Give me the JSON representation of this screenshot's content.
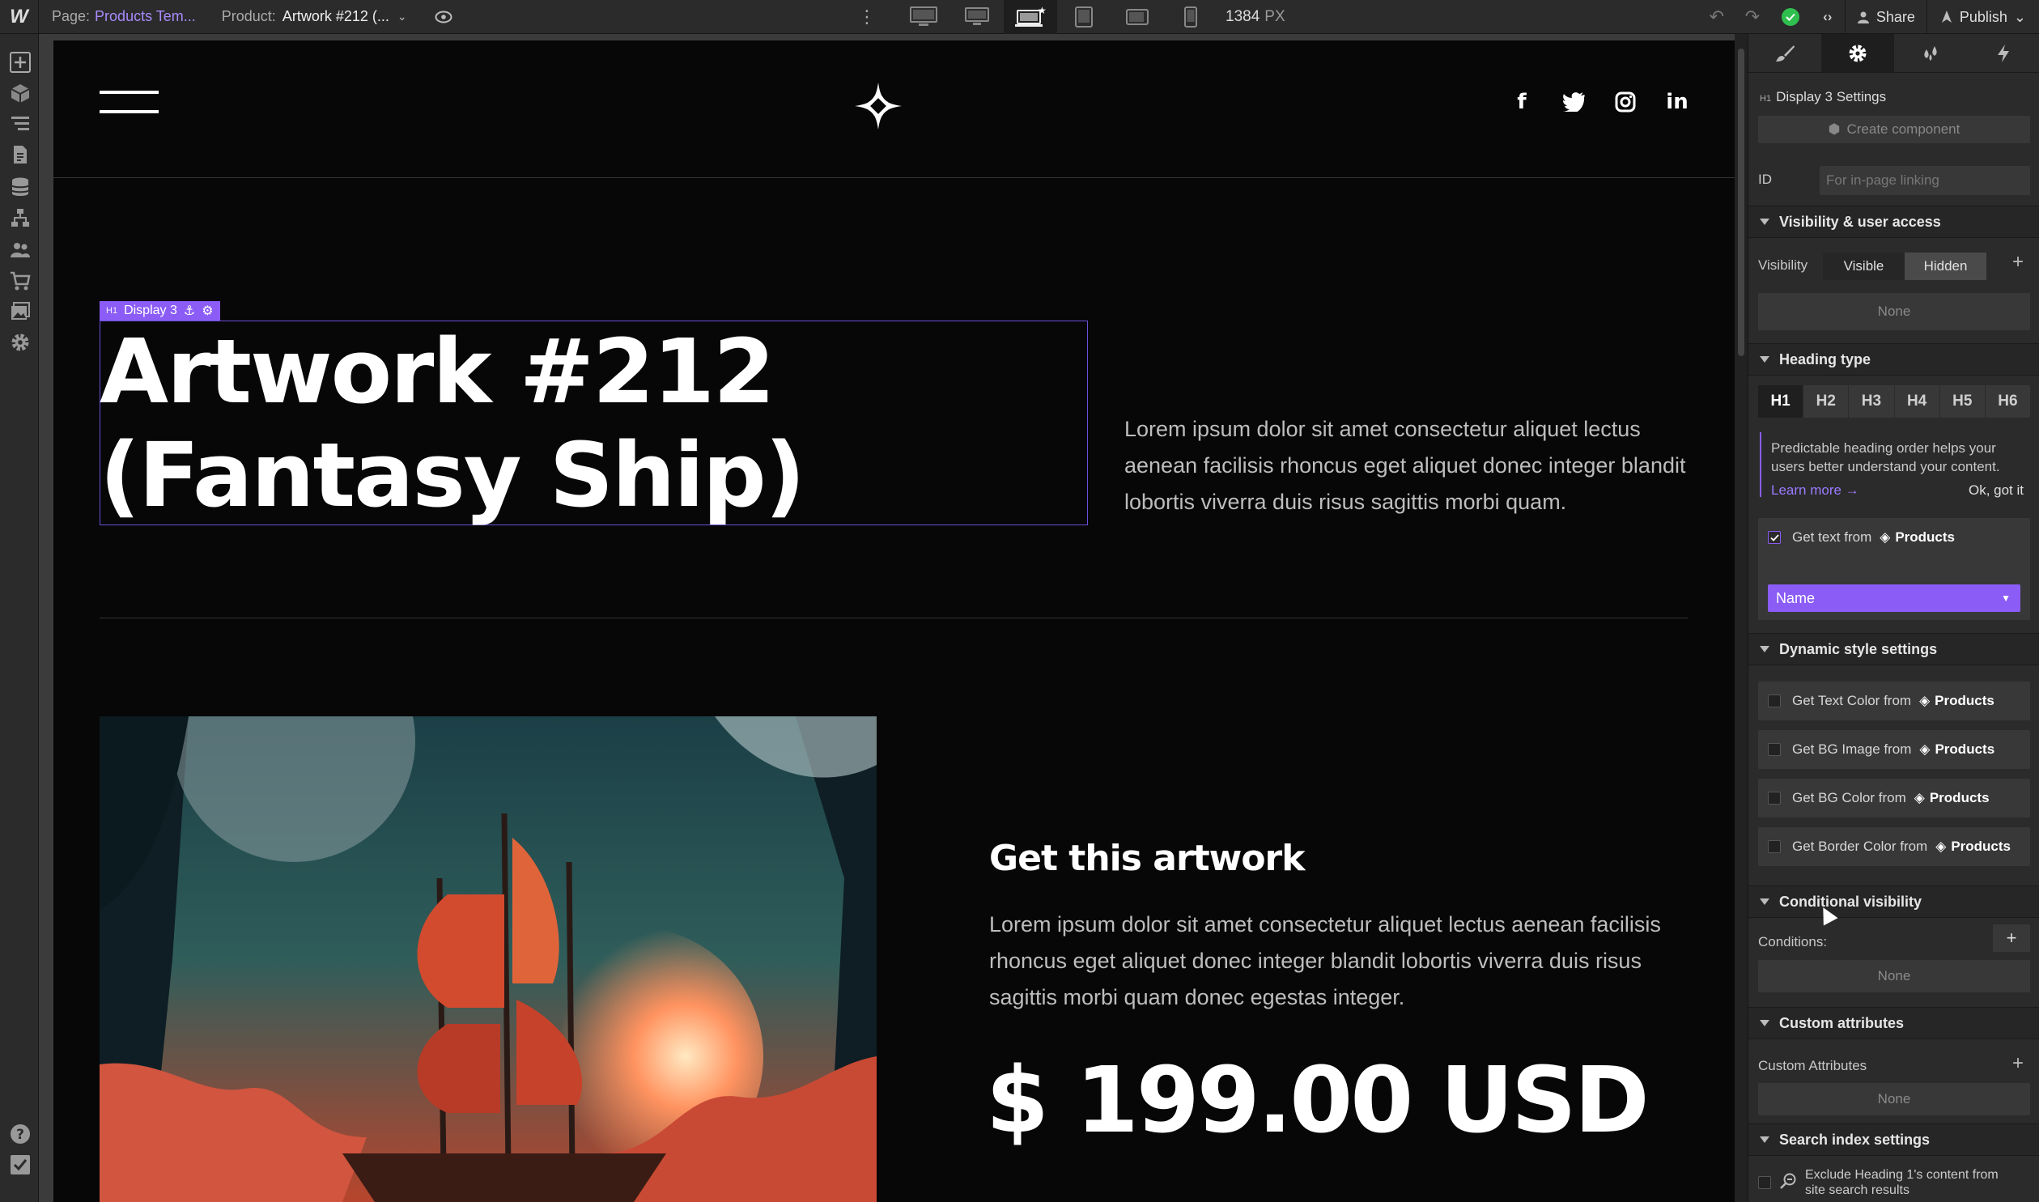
{
  "topbar": {
    "logo": "W",
    "page_label": "Page:",
    "page_name": "Products Tem...",
    "product_label": "Product:",
    "product_name": "Artwork #212 (...",
    "width_value": "1384",
    "width_unit": "PX",
    "share_label": "Share",
    "publish_label": "Publish",
    "status_color": "#2fbf4f"
  },
  "canvas": {
    "selection_tag": "Display 3",
    "selection_tag_prefix": "H1",
    "hero_title_line1": "Artwork #212",
    "hero_title_line2": "(Fantasy Ship)",
    "hero_description": "Lorem ipsum dolor sit amet consectetur aliquet lectus aenean facilisis rhoncus eget aliquet donec integer blandit lobortis viverra duis risus sagittis morbi quam.",
    "cta_title": "Get this artwork",
    "cta_description": "Lorem ipsum dolor sit amet consectetur aliquet lectus aenean facilisis rhoncus eget aliquet donec integer blandit lobortis viverra duis risus sagittis morbi quam donec egestas integer.",
    "price": "$ 199.00 USD",
    "socials": [
      "facebook-icon",
      "twitter-icon",
      "instagram-icon",
      "linkedin-icon"
    ],
    "social_glyphs": {
      "facebook": "f",
      "linkedin": "in"
    },
    "accent_color": "#8b5cf6"
  },
  "panel": {
    "element_prefix": "H1",
    "element_title": "Display 3 Settings",
    "create_component": "Create component",
    "id_label": "ID",
    "id_placeholder": "For in-page linking",
    "visibility_section": "Visibility & user access",
    "visibility_label": "Visibility",
    "visible_btn": "Visible",
    "hidden_btn": "Hidden",
    "visibility_none": "None",
    "heading_section": "Heading type",
    "heading_levels": [
      "H1",
      "H2",
      "H3",
      "H4",
      "H5",
      "H6"
    ],
    "heading_info": "Predictable heading order helps your users better understand your content.",
    "learn_more": "Learn more →",
    "ok_got_it": "Ok, got it",
    "get_text_from": "Get text from",
    "collection": "Products",
    "field_select": "Name",
    "dynamic_section": "Dynamic style settings",
    "dynamic_rows": [
      "Get Text Color from",
      "Get BG Image from",
      "Get BG Color from",
      "Get Border Color from"
    ],
    "conditional_section": "Conditional visibility",
    "conditions_label": "Conditions:",
    "conditions_none": "None",
    "custom_section": "Custom attributes",
    "custom_label": "Custom Attributes",
    "custom_none": "None",
    "search_section": "Search index settings",
    "search_exclude": "Exclude Heading 1's content from site search results"
  }
}
